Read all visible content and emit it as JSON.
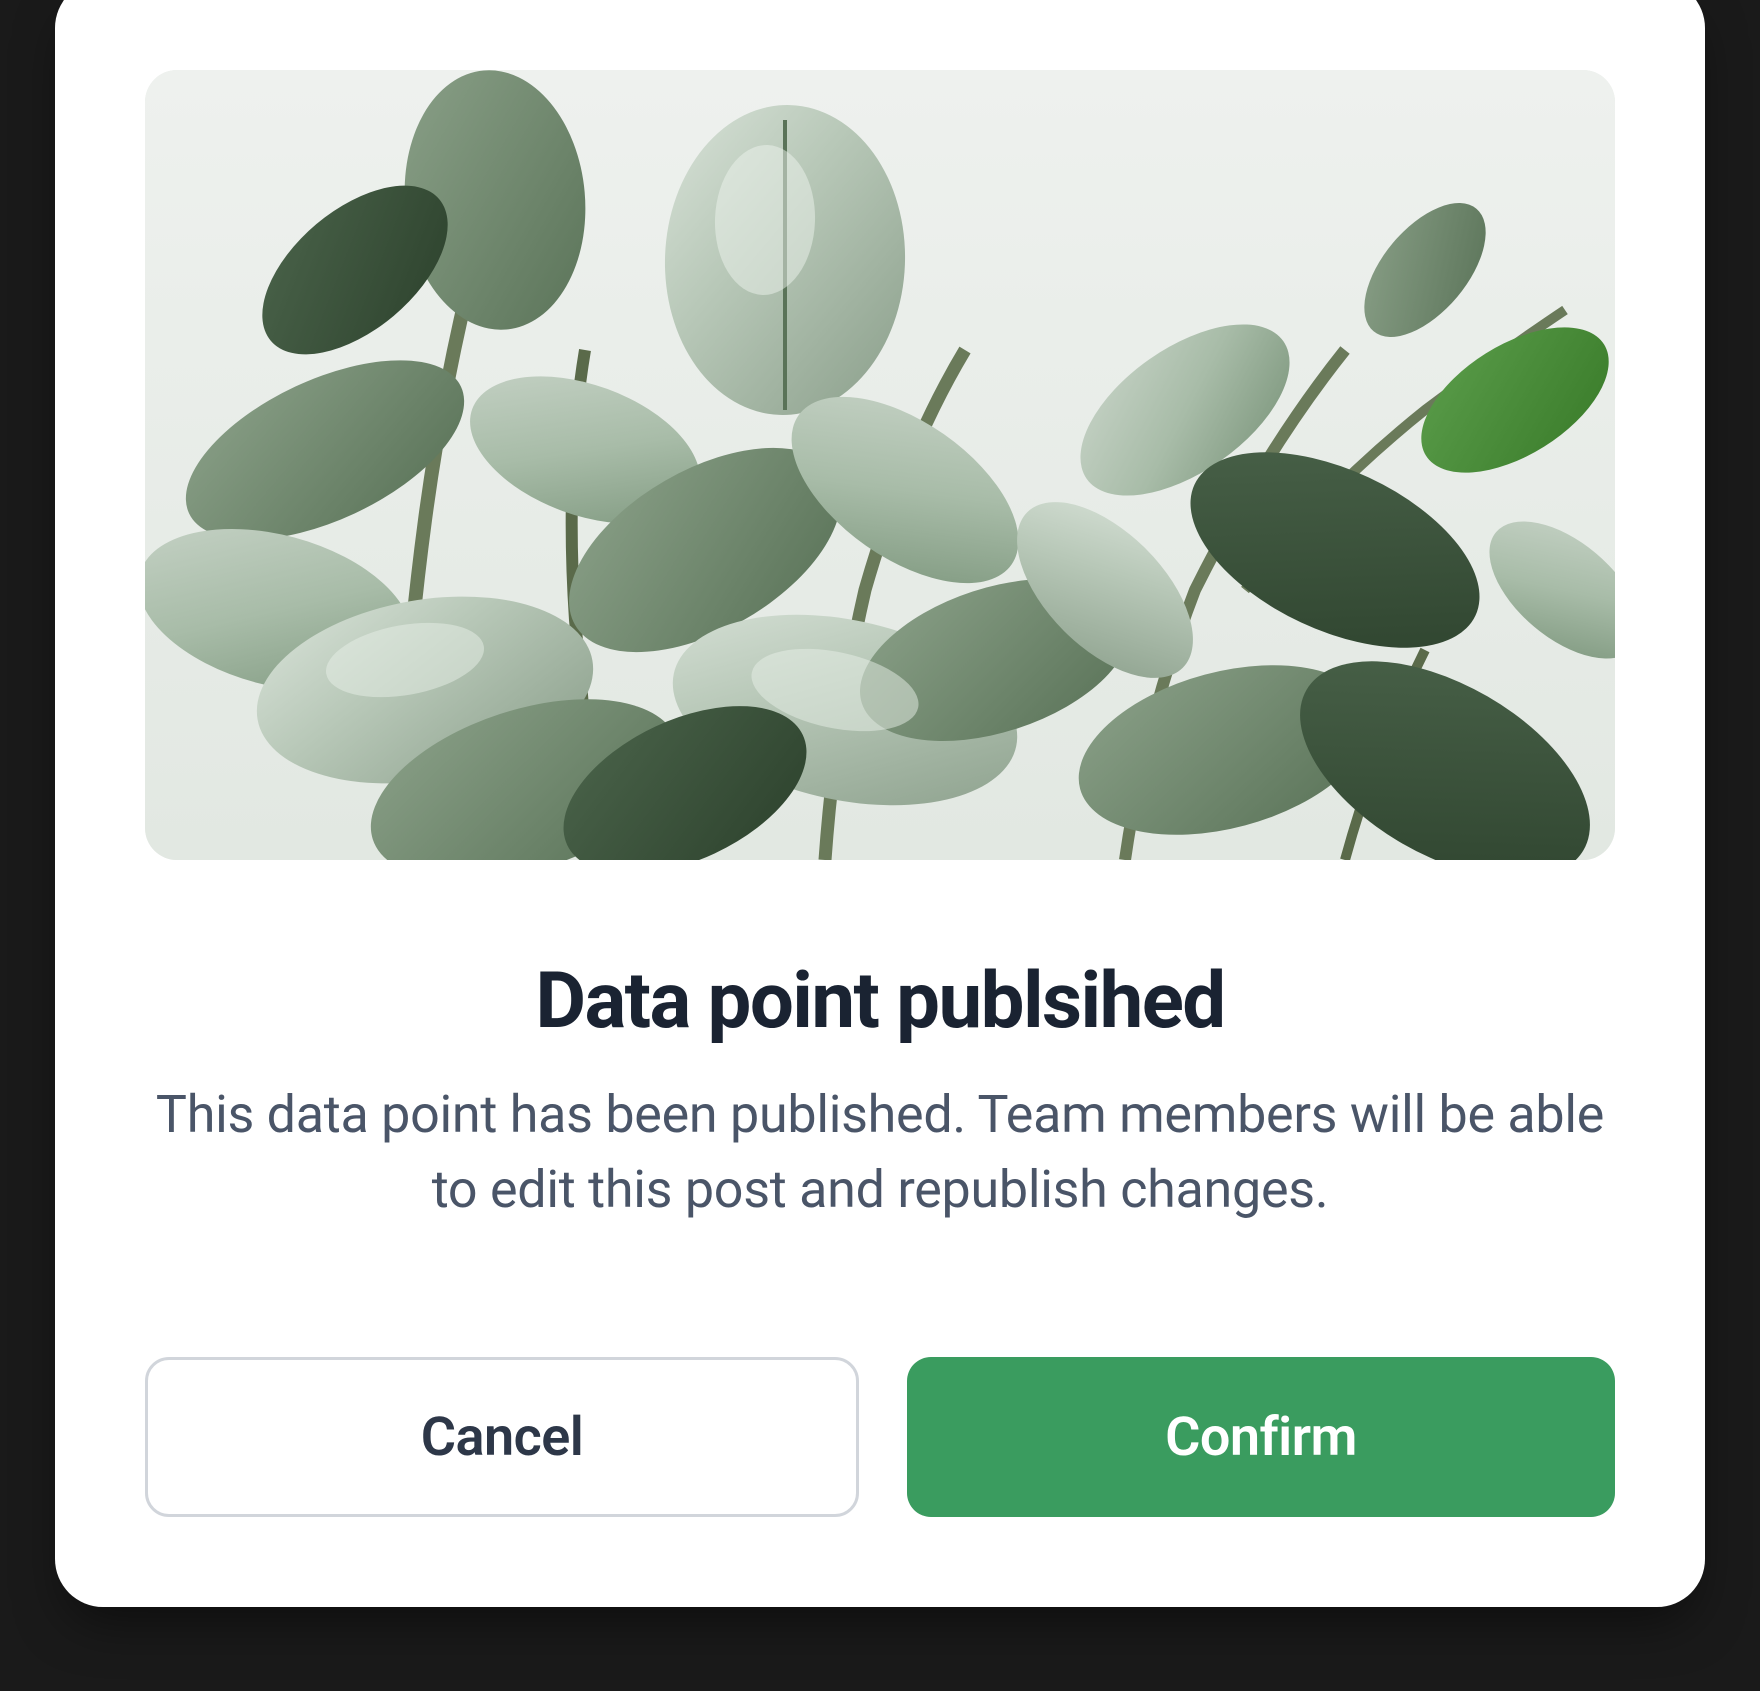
{
  "modal": {
    "image": {
      "name": "plant-hero-image",
      "alt": "Green leafy plant"
    },
    "title": "Data point publsihed",
    "description": "This data point has been published. Team members will be able to edit this post and republish changes.",
    "actions": {
      "cancel_label": "Cancel",
      "confirm_label": "Confirm"
    },
    "colors": {
      "primary": "#3a9c5f",
      "title": "#1a2332",
      "body": "#4a5568",
      "border": "#d1d5db"
    }
  }
}
